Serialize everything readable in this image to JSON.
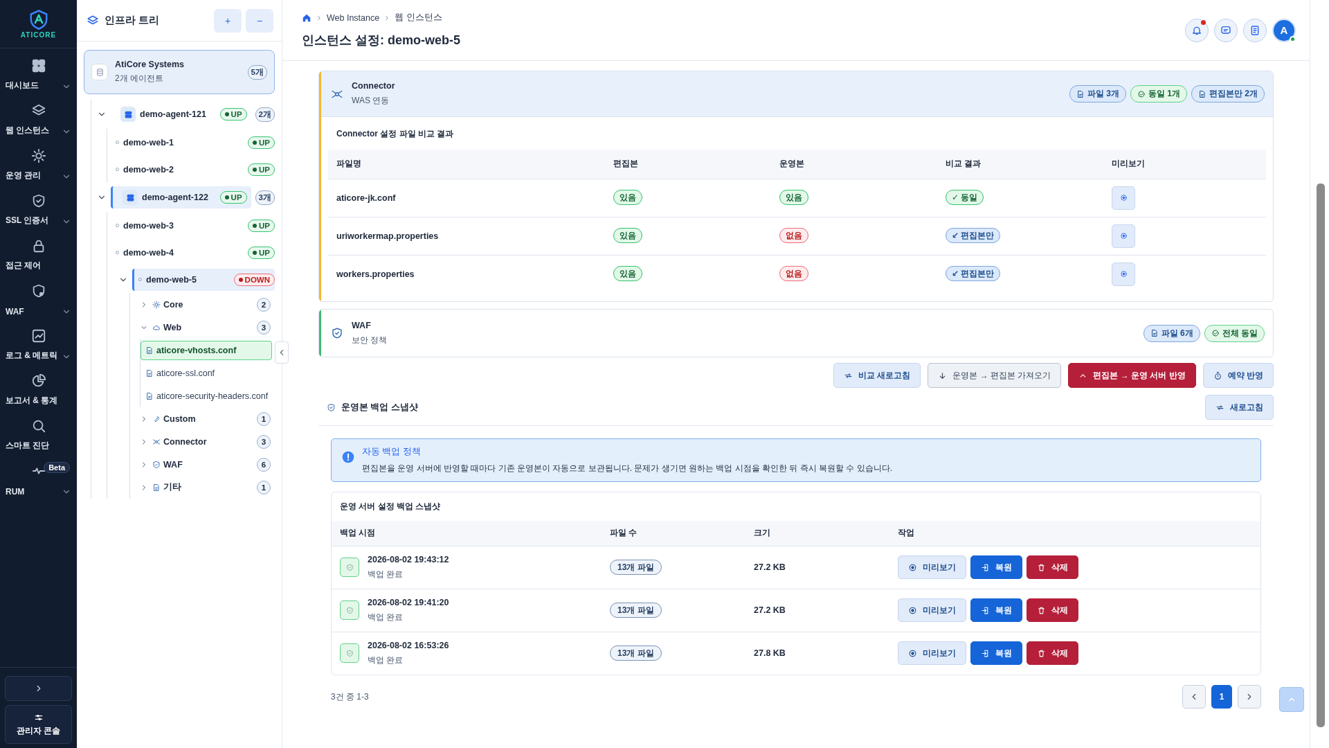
{
  "sidebar": {
    "logo": "ATICORE",
    "items": [
      {
        "label": "대시보드",
        "expandable": true
      },
      {
        "label": "웹 인스턴스",
        "expandable": true
      },
      {
        "label": "운영 관리",
        "expandable": true
      },
      {
        "label": "SSL 인증서",
        "expandable": true
      },
      {
        "label": "접근 제어",
        "expandable": false
      },
      {
        "label": "WAF",
        "expandable": true
      },
      {
        "label": "로그 & 메트릭",
        "expandable": true
      },
      {
        "label": "보고서 & 통계",
        "expandable": false
      },
      {
        "label": "스마트 진단",
        "expandable": false
      },
      {
        "label": "RUM",
        "expandable": true,
        "badge": "Beta"
      }
    ],
    "admin": "관리자 콘솔"
  },
  "tree": {
    "title": "인프라 트리",
    "buttons": [
      "+",
      "−"
    ],
    "root": {
      "name": "AtiCore Systems",
      "subtitle": "2개 에이전트",
      "count": "5개"
    },
    "agents": [
      {
        "name": "demo-agent-121",
        "status": "UP",
        "healthy": true,
        "count": "2개",
        "expanded": true,
        "selected": false,
        "children": [
          {
            "name": "demo-web-1",
            "status": "UP",
            "healthy": true,
            "expanded": false,
            "selected": false
          },
          {
            "name": "demo-web-2",
            "status": "UP",
            "healthy": true,
            "expanded": false,
            "selected": false
          }
        ]
      },
      {
        "name": "demo-agent-122",
        "status": "UP",
        "healthy": true,
        "count": "3개",
        "expanded": true,
        "selected": true,
        "children": [
          {
            "name": "demo-web-3",
            "status": "UP",
            "healthy": true,
            "expanded": false,
            "selected": false
          },
          {
            "name": "demo-web-4",
            "status": "UP",
            "healthy": true,
            "expanded": false,
            "selected": false
          },
          {
            "name": "demo-web-5",
            "status": "DOWN",
            "healthy": false,
            "expanded": true,
            "selected": true,
            "children": [
              {
                "name": "Core",
                "count": "2",
                "expanded": false
              },
              {
                "name": "Web",
                "count": "3",
                "expanded": true,
                "children": [
                  {
                    "name": "aticore-vhosts.conf",
                    "selected": true
                  },
                  {
                    "name": "aticore-ssl.conf",
                    "selected": false
                  },
                  {
                    "name": "aticore-security-headers.conf",
                    "selected": false
                  }
                ]
              },
              {
                "name": "Custom",
                "count": "1",
                "expanded": false
              },
              {
                "name": "Connector",
                "count": "3",
                "expanded": false
              },
              {
                "name": "WAF",
                "count": "6",
                "expanded": false
              },
              {
                "name": "기타",
                "count": "1",
                "expanded": false
              }
            ]
          }
        ]
      }
    ]
  },
  "header": {
    "breadcrumb": [
      "Web Instance",
      "웹 인스턴스"
    ],
    "title": "인스턴스 설정: demo-web-5",
    "unread": true,
    "avatar": "A",
    "online": true
  },
  "sections": [
    {
      "title": "Connector",
      "subtitle": "WAS 연동",
      "color": "#f5b82e",
      "expanded": true,
      "badges": [
        {
          "text": "파일 3개",
          "positive": false
        },
        {
          "text": "동일 1개",
          "positive": true
        },
        {
          "text": "편집본만 2개",
          "positive": false
        }
      ],
      "caption": "Connector 설정 파일 비교 결과",
      "columns": [
        "파일명",
        "편집본",
        "운영본",
        "비교 결과",
        "미리보기"
      ],
      "rows": [
        {
          "file": "aticore-jk.conf",
          "edited": {
            "text": "있음",
            "present": true
          },
          "live": {
            "text": "있음",
            "present": true
          },
          "result": {
            "text": "✓ 동일",
            "same": true
          }
        },
        {
          "file": "uriworkermap.properties",
          "edited": {
            "text": "있음",
            "present": true
          },
          "live": {
            "text": "없음",
            "present": false
          },
          "result": {
            "text": "↙ 편집본만",
            "same": false
          }
        },
        {
          "file": "workers.properties",
          "edited": {
            "text": "있음",
            "present": true
          },
          "live": {
            "text": "없음",
            "present": false
          },
          "result": {
            "text": "↙ 편집본만",
            "same": false
          }
        }
      ]
    },
    {
      "title": "WAF",
      "subtitle": "보안 정책",
      "color": "#3dbb74",
      "expanded": false,
      "badges": [
        {
          "text": "파일 6개",
          "positive": false
        },
        {
          "text": "전체 동일",
          "positive": true
        }
      ]
    }
  ],
  "actions": [
    {
      "label": "비교 새로고침",
      "kind": "soft"
    },
    {
      "label": "운영본 → 편집본 가져오기",
      "kind": "neutral"
    },
    {
      "label": "편집본 → 운영 서버 반영",
      "kind": "danger"
    },
    {
      "label": "예약 반영",
      "kind": "soft"
    }
  ],
  "backup": {
    "title": "운영본 백업 스냅샷",
    "refresh": "새로고침",
    "notice": {
      "title": "자동 백업 정책",
      "text": "편집본을 운영 서버에 반영할 때마다 기존 운영본이 자동으로 보관됩니다. 문제가 생기면 원하는 백업 시점을 확인한 뒤 즉시 복원할 수 있습니다."
    },
    "table_title": "운영 서버 설정 백업 스냅샷",
    "columns": [
      "백업 시점",
      "파일 수",
      "크기",
      "작업"
    ],
    "rows": [
      {
        "time": "2026-08-02 19:43:12",
        "status": "백업 완료",
        "files": "13개 파일",
        "size": "27.2 KB",
        "actions": [
          "미리보기",
          "복원",
          "삭제"
        ]
      },
      {
        "time": "2026-08-02 19:41:20",
        "status": "백업 완료",
        "files": "13개 파일",
        "size": "27.2 KB",
        "actions": [
          "미리보기",
          "복원",
          "삭제"
        ]
      },
      {
        "time": "2026-08-02 16:53:26",
        "status": "백업 완료",
        "files": "13개 파일",
        "size": "27.8 KB",
        "actions": [
          "미리보기",
          "복원",
          "삭제"
        ]
      }
    ],
    "summary": "3건 중 1-3",
    "pages": [
      {
        "label": "1",
        "selected": true
      }
    ]
  }
}
